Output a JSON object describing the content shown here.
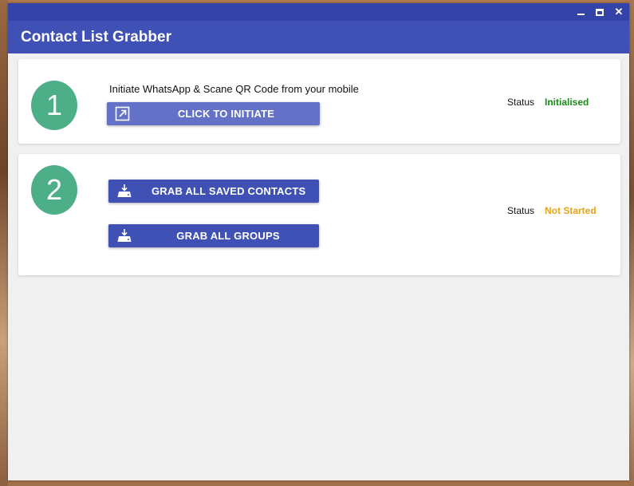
{
  "window": {
    "minimize_icon": "minimize-icon",
    "maximize_icon": "maximize-icon",
    "close_icon": "close-icon",
    "close_glyph": "✕"
  },
  "app": {
    "title": "Contact List Grabber",
    "accent_color": "#3f51b5"
  },
  "steps": [
    {
      "number": "1",
      "instruction": "Initiate WhatsApp & Scane QR Code from your mobile",
      "button": {
        "label": "CLICK TO INITIATE",
        "icon": "open-external-icon"
      },
      "status_label": "Status",
      "status_value": "Initialised",
      "status_color": "#1a8a1a"
    },
    {
      "number": "2",
      "buttons": [
        {
          "label": "GRAB ALL SAVED CONTACTS",
          "icon": "download-tray-icon"
        },
        {
          "label": "GRAB ALL GROUPS",
          "icon": "download-tray-icon"
        }
      ],
      "status_label": "Status",
      "status_value": "Not Started",
      "status_color": "#e8a317"
    }
  ]
}
